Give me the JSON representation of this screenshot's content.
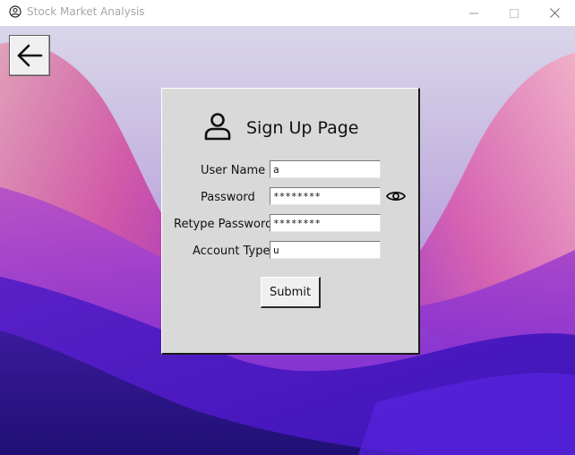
{
  "window": {
    "title": "Stock Market Analysis",
    "controls": {
      "minimize": "—",
      "maximize": "☐",
      "close": "✕"
    }
  },
  "back_button": {
    "icon": "arrow-left-icon"
  },
  "form": {
    "title": "Sign Up Page",
    "fields": [
      {
        "label": "User Name",
        "value": "a"
      },
      {
        "label": "Password",
        "value": "********"
      },
      {
        "label": "Retype Password",
        "value": "********"
      },
      {
        "label": "Account Type",
        "value": "u"
      }
    ],
    "submit_label": "Submit"
  },
  "colors": {
    "panel_bg": "#d9d9d9",
    "title_text": "#a7a7a7"
  }
}
